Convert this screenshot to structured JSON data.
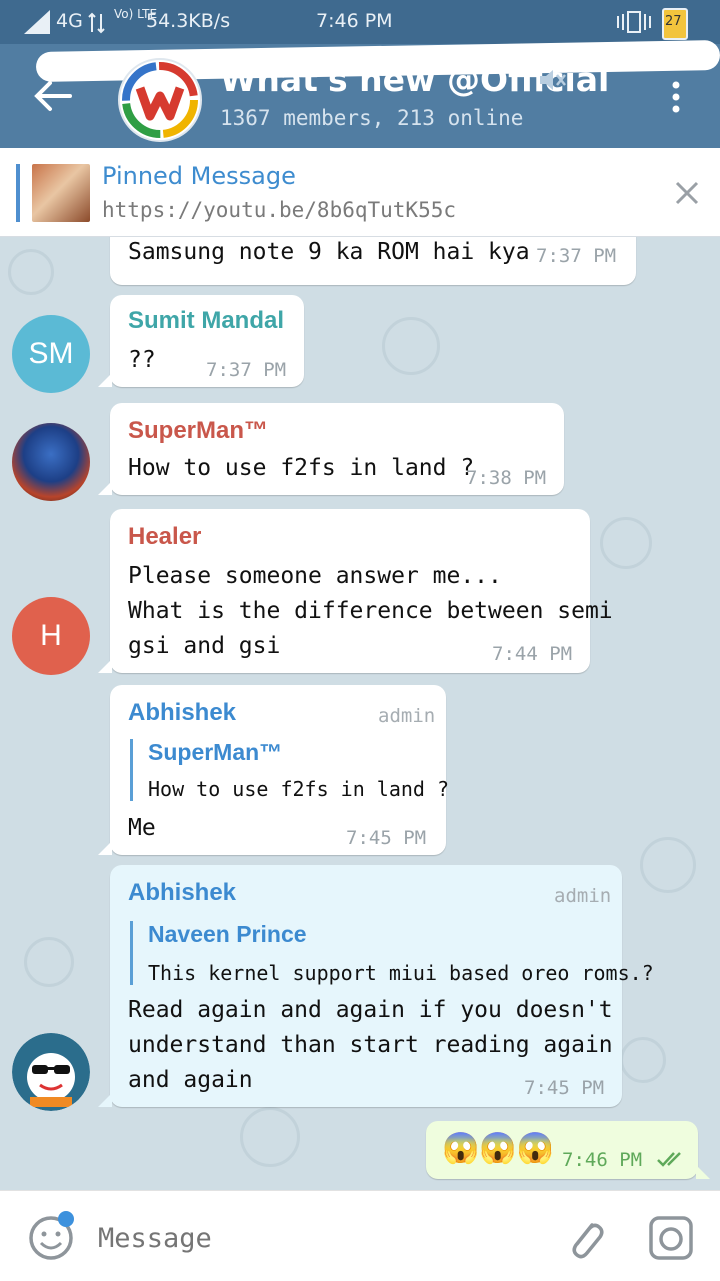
{
  "status_bar": {
    "network": "4G",
    "volte": "Vo) LTE",
    "speed": "54.3KB/s",
    "time": "7:46 PM",
    "battery": "27"
  },
  "header": {
    "title": "What's new @Official",
    "subtitle": "1367 members, 213 online"
  },
  "pinned": {
    "title": "Pinned Message",
    "link": "https://youtu.be/8b6qTutK55c"
  },
  "messages": [
    {
      "text": "Samsung note 9 ka ROM hai kya",
      "time": "7:37 PM"
    },
    {
      "sender": "Sumit Mandal",
      "avatar_initials": "SM",
      "text": "??",
      "time": "7:37 PM"
    },
    {
      "sender": "SuperMan™",
      "text": "How to use f2fs in land ?",
      "time": "7:38 PM"
    },
    {
      "sender": "Healer",
      "avatar_initials": "H",
      "lines": [
        "Please someone answer me...",
        "What is the difference between semi",
        "gsi and gsi"
      ],
      "time": "7:44 PM"
    },
    {
      "sender": "Abhishek",
      "badge": "admin",
      "quote_name": "SuperMan™",
      "quote_text": "How to use f2fs in land ?",
      "text": "Me",
      "time": "7:45 PM"
    },
    {
      "sender": "Abhishek",
      "badge": "admin",
      "quote_name": "Naveen Prince",
      "quote_text": "This kernel support miui based oreo roms.?",
      "lines": [
        "Read again and again if you doesn't",
        "understand than start reading again",
        "and again"
      ],
      "time": "7:45 PM"
    },
    {
      "text": "😱😱😱",
      "time": "7:46 PM"
    }
  ],
  "input": {
    "placeholder": "Message"
  },
  "colors": {
    "header": "#517da2",
    "sender_sumit": "#3fa6a8",
    "sender_superman": "#c9574b",
    "sender_healer": "#c9574b",
    "sender_abhishek": "#3c8ad0"
  }
}
